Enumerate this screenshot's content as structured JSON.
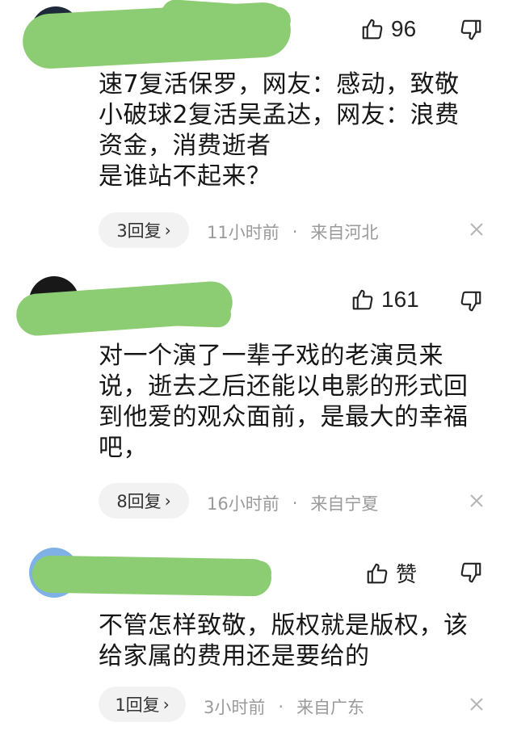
{
  "comments": [
    {
      "likes": "96",
      "text": "速7复活保罗，网友：感动，致敬\n小破球2复活吴孟达，网友：浪费\n资金，消费逝者\n是谁站不起来？",
      "reply_label": "3回复",
      "time": "11小时前",
      "location": "来自河北"
    },
    {
      "likes": "161",
      "text": "对一个演了一辈子戏的老演员来\n说，逝去之后还能以电影的形式回\n到他爱的观众面前，是最大的幸福\n吧，",
      "reply_label": "8回复",
      "time": "16小时前",
      "location": "来自宁夏"
    },
    {
      "likes": "赞",
      "text": "不管怎样致敬，版权就是版权，该\n给家属的费用还是要给的",
      "reply_label": "1回复",
      "time": "3小时前",
      "location": "来自广东"
    }
  ],
  "meta_separator": "·",
  "icons": {
    "like": "thumbs-up-icon",
    "dislike": "thumbs-down-icon",
    "close": "close-icon",
    "chevron": "chevron-right-icon"
  },
  "colors": {
    "scribble": "#8ccc72",
    "pill_bg": "#f2f2f2",
    "meta_text": "#9a9a9a"
  }
}
